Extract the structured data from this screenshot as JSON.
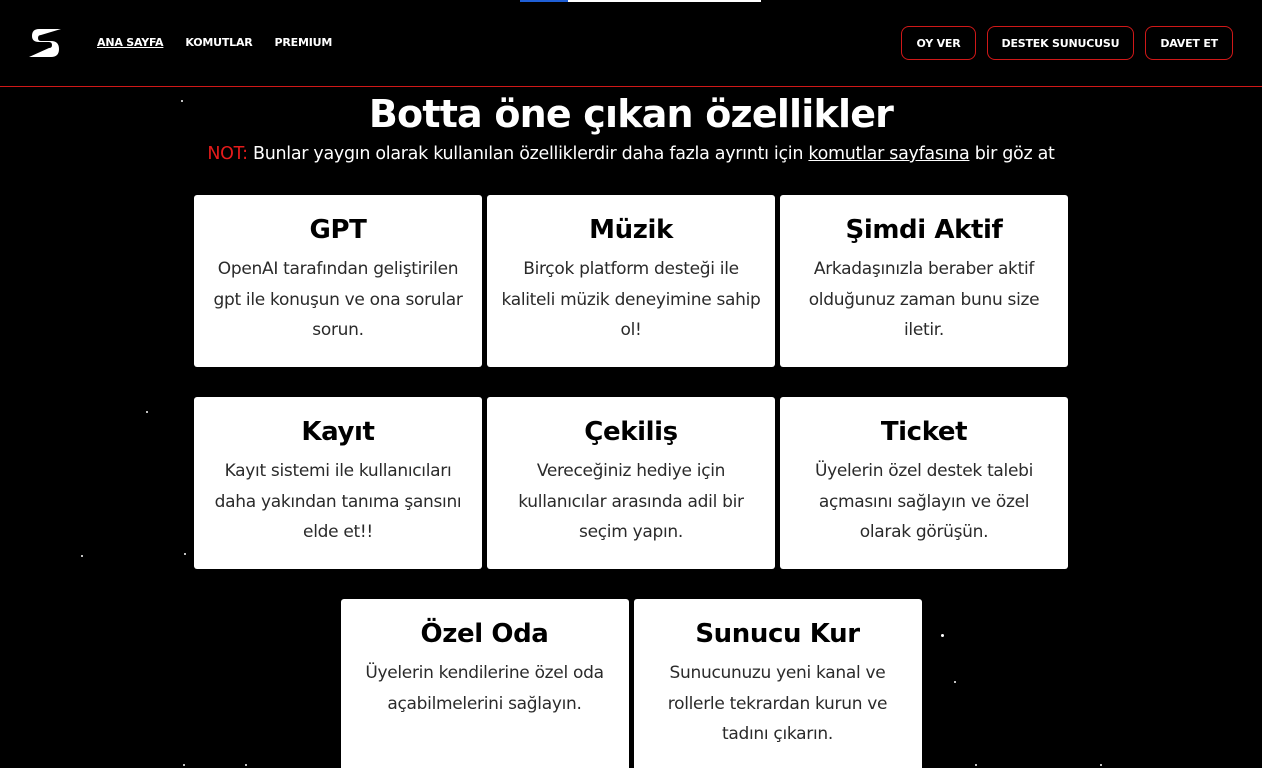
{
  "nav": {
    "logo_icon": "s-logo-icon",
    "links": [
      "ANA SAYFA",
      "KOMUTLAR",
      "PREMIUM"
    ],
    "buttons": [
      "OY VER",
      "DESTEK SUNUCUSU",
      "DAVET ET"
    ]
  },
  "hero": {
    "title": "Botta öne çıkan özellikler",
    "note_label": "NOT:",
    "note_text": " Bunlar yaygın olarak kullanılan özelliklerdir daha fazla ayrıntı için ",
    "note_link": "komutlar sayfasına",
    "note_tail": " bir göz at"
  },
  "features": [
    {
      "title": "GPT",
      "description": "OpenAI tarafından geliştirilen gpt ile konuşun ve ona sorular sorun."
    },
    {
      "title": "Müzik",
      "description": "Birçok platform desteği ile kaliteli müzik deneyimine sahip ol!"
    },
    {
      "title": "Şimdi Aktif",
      "description": "Arkadaşınızla beraber aktif olduğunuz zaman bunu size iletir."
    },
    {
      "title": "Kayıt",
      "description": "Kayıt sistemi ile kullanıcıları daha yakından tanıma şansını elde et!!"
    },
    {
      "title": "Çekiliş",
      "description": "Vereceğiniz hediye için kullanıcılar arasında adil bir seçim yapın."
    },
    {
      "title": "Ticket",
      "description": "Üyelerin özel destek talebi açmasını sağlayın ve özel olarak görüşün."
    },
    {
      "title": "Özel Oda",
      "description": "Üyelerin kendilerine özel oda açabilmelerini sağlayın."
    },
    {
      "title": "Sunucu Kur",
      "description": "Sunucunuzu yeni kanal ve rollerle tekrardan kurun ve tadını çıkarın."
    }
  ],
  "colors": {
    "background": "#000000",
    "accent_red": "#d01818",
    "note_red": "#e51b1b",
    "card_bg": "#ffffff"
  }
}
